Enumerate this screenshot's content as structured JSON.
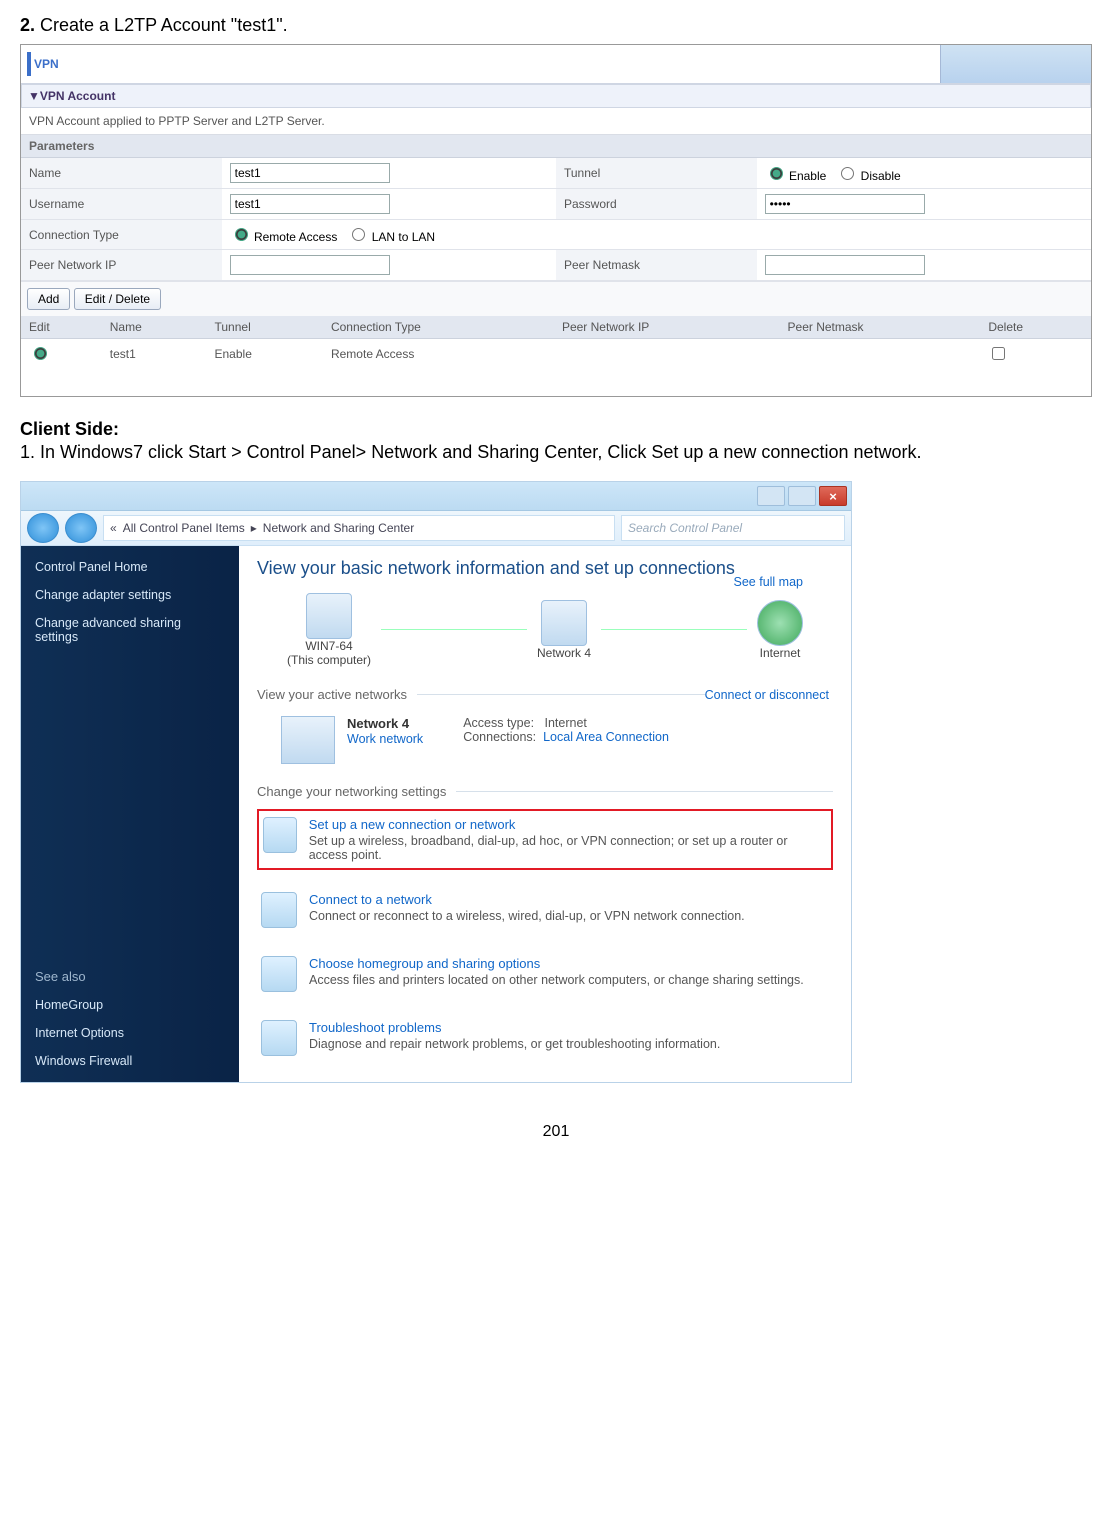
{
  "doc": {
    "step2": {
      "prefix": "2.",
      "text": " Create a L2TP Account \"test1\"."
    },
    "client_side_head": "Client Side:",
    "step_client": "1. In Windows7 click ",
    "start": "Start",
    "gt1": " > ",
    "cp": "Control Panel",
    "gt2": "> ",
    "nsc": "Network and Sharing Center,",
    "click": " Click ",
    "setup": "Set up a new connection network",
    "period": ".",
    "page_num": "201"
  },
  "vpn": {
    "title": "VPN",
    "section": "▼VPN Account",
    "caption": "VPN Account applied to PPTP Server and L2TP Server.",
    "parameters": "Parameters",
    "rows": {
      "name_lbl": "Name",
      "name_val": "test1",
      "tunnel_lbl": "Tunnel",
      "enable": "Enable",
      "disable": "Disable",
      "user_lbl": "Username",
      "user_val": "test1",
      "pass_lbl": "Password",
      "pass_val": "•••••",
      "conn_lbl": "Connection Type",
      "remote": "Remote Access",
      "lan": "LAN to LAN",
      "peerip_lbl": "Peer Network IP",
      "peermask_lbl": "Peer Netmask"
    },
    "buttons": {
      "add": "Add",
      "edit": "Edit / Delete"
    },
    "grid_headers": {
      "edit": "Edit",
      "name": "Name",
      "tunnel": "Tunnel",
      "conn": "Connection Type",
      "peerip": "Peer Network IP",
      "peermask": "Peer Netmask",
      "del": "Delete"
    },
    "grid_row": {
      "name": "test1",
      "tunnel": "Enable",
      "conn": "Remote Access"
    }
  },
  "win7": {
    "breadcrumb_arrow": "«",
    "breadcrumb1": "All Control Panel Items",
    "breadcrumb_sep": "▸",
    "breadcrumb2": "Network and Sharing Center",
    "search_ph": "Search Control Panel",
    "side": {
      "home": "Control Panel Home",
      "adapter": "Change adapter settings",
      "adv": "Change advanced sharing settings",
      "seealso": "See also",
      "hg": "HomeGroup",
      "io": "Internet Options",
      "wf": "Windows Firewall"
    },
    "main": {
      "head": "View your basic network information and set up connections",
      "see_full": "See full map",
      "comp": "WIN7-64",
      "comp_sub": "(This computer)",
      "net": "Network  4",
      "inet": "Internet",
      "active_head": "View your active networks",
      "conn_link": "Connect or disconnect",
      "net_name": "Network  4",
      "work": "Work network",
      "acc_lbl": "Access type:",
      "acc_val": "Internet",
      "conn_lbl": "Connections:",
      "conn_val": "Local Area Connection",
      "chg_head": "Change your networking settings",
      "opts": {
        "setup_t": "Set up a new connection or network",
        "setup_d": "Set up a wireless, broadband, dial-up, ad hoc, or VPN connection; or set up a router or access point.",
        "conn_t": "Connect to a network",
        "conn_d": "Connect or reconnect to a wireless, wired, dial-up, or VPN network connection.",
        "hg_t": "Choose homegroup and sharing options",
        "hg_d": "Access files and printers located on other network computers, or change sharing settings.",
        "tr_t": "Troubleshoot problems",
        "tr_d": "Diagnose and repair network problems, or get troubleshooting information."
      }
    }
  }
}
